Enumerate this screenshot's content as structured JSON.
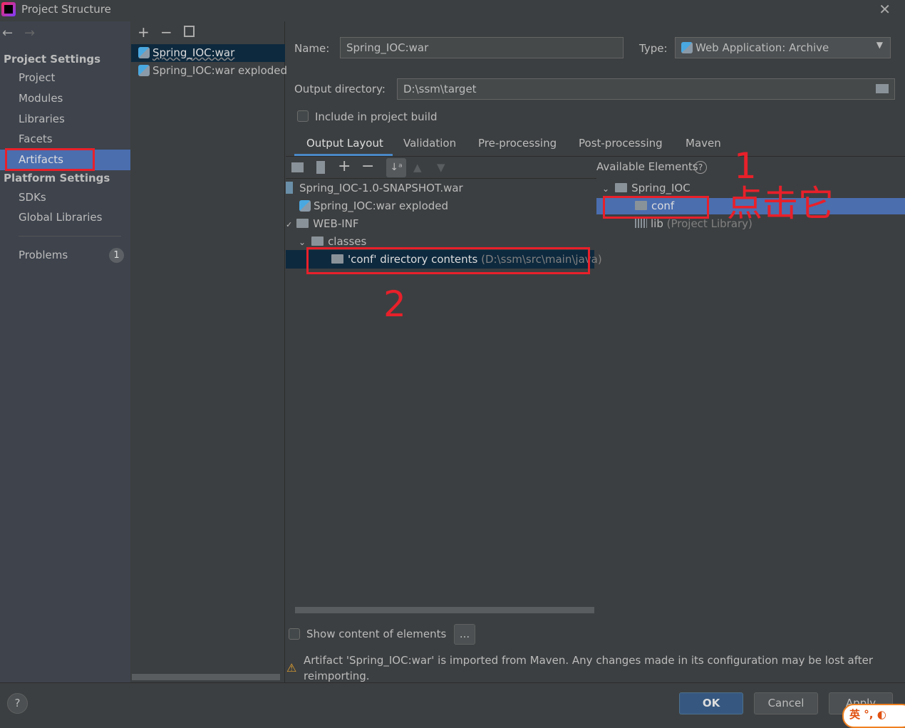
{
  "window": {
    "title": "Project Structure"
  },
  "sidebar": {
    "project_settings": "Project Settings",
    "items": [
      "Project",
      "Modules",
      "Libraries",
      "Facets",
      "Artifacts"
    ],
    "platform_settings": "Platform Settings",
    "platform_items": [
      "SDKs",
      "Global Libraries"
    ],
    "problems": "Problems",
    "problems_count": "1"
  },
  "artifacts": [
    "Spring_IOC:war",
    "Spring_IOC:war exploded"
  ],
  "form": {
    "name_label": "Name:",
    "name_value": "Spring_IOC:war",
    "type_label": "Type:",
    "type_value": "Web Application: Archive",
    "output_label": "Output directory:",
    "output_value": "D:\\ssm\\target",
    "include_label": "Include in project build"
  },
  "tabs": [
    "Output Layout",
    "Validation",
    "Pre-processing",
    "Post-processing",
    "Maven"
  ],
  "layout_tree": {
    "root": "Spring_IOC-1.0-SNAPSHOT.war",
    "exploded": "Spring_IOC:war exploded",
    "webinf": "WEB-INF",
    "classes": "classes",
    "conf_contents": "'conf' directory contents",
    "conf_path": "(D:\\ssm\\src\\main\\java)"
  },
  "available": {
    "title": "Available Elements",
    "module": "Spring_IOC",
    "conf": "conf",
    "lib": "lib",
    "lib_note": "(Project Library)"
  },
  "annotations": {
    "one": "1",
    "click": "点击它",
    "two": "2"
  },
  "bottom": {
    "show_content": "Show content of elements",
    "ellipsis": "...",
    "warning": "Artifact 'Spring_IOC:war' is imported from Maven. Any changes made in its configuration may be lost after reimporting."
  },
  "footer": {
    "help": "?",
    "ok": "OK",
    "cancel": "Cancel",
    "apply": "Apply",
    "ime": "英"
  }
}
